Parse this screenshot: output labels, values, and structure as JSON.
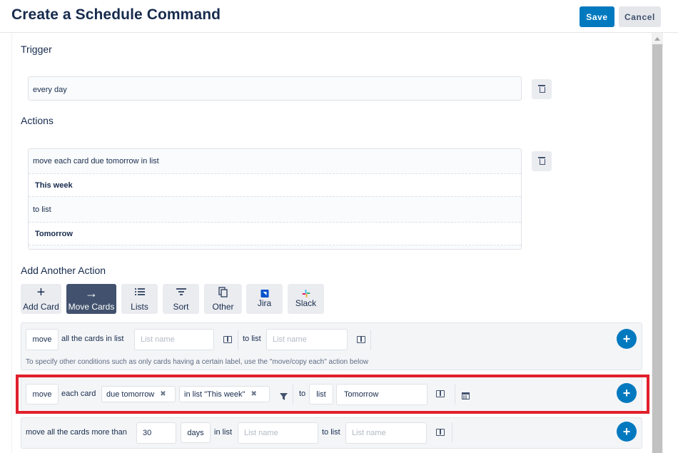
{
  "header": {
    "title": "Create a Schedule Command",
    "save_label": "Save",
    "cancel_label": "Cancel"
  },
  "trigger": {
    "heading": "Trigger",
    "value": "every day"
  },
  "actions": {
    "heading": "Actions",
    "rows": [
      "move each card due tomorrow in list",
      "This week",
      "to list",
      "Tomorrow"
    ]
  },
  "add_action": {
    "heading": "Add Another Action",
    "types": [
      {
        "label": "Add Card",
        "icon": "plus-icon"
      },
      {
        "label": "Move Cards",
        "icon": "arrow-right-icon",
        "active": true
      },
      {
        "label": "Lists",
        "icon": "list-icon"
      },
      {
        "label": "Sort",
        "icon": "sort-icon"
      },
      {
        "label": "Other",
        "icon": "copy-icon"
      },
      {
        "label": "Jira",
        "icon": "jira-icon"
      },
      {
        "label": "Slack",
        "icon": "slack-icon"
      }
    ]
  },
  "panels": {
    "move_all": {
      "verb": "move",
      "text1": "all the cards in list",
      "list_placeholder": "List name",
      "to_list": "to list",
      "to_list_placeholder": "List name",
      "note": "To specify other conditions such as only cards having a certain label, use the \"move/copy each\" action below"
    },
    "move_each": {
      "verb": "move",
      "text1": "each card",
      "filter1": "due tomorrow",
      "filter2": "in list \"This week\"",
      "to": "to",
      "list": "list",
      "target": "Tomorrow",
      "remove_glyph": "✖"
    },
    "move_older": {
      "text1": "move all the cards more than",
      "number": "30",
      "unit": "days",
      "in_list": "in list",
      "list_placeholder": "List name",
      "to_list": "to list",
      "to_list_placeholder": "List name"
    }
  },
  "colors": {
    "primary": "#0079bf",
    "highlight": "#e0202c",
    "active_button": "#42526e"
  }
}
